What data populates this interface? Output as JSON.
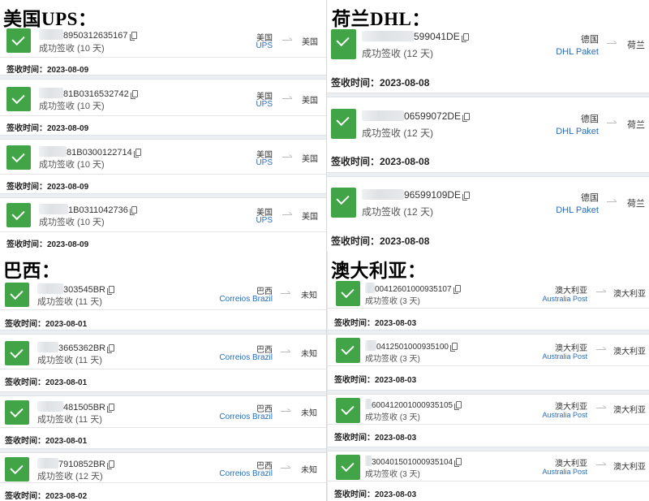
{
  "sections": {
    "us": {
      "heading": "美国UPS：",
      "shipments": [
        {
          "tracking": "8950312635167",
          "status": "成功签收 (10 天)",
          "origin": "美国",
          "carrier": "UPS",
          "destination": "美国",
          "signed": "签收时间：2023-08-09"
        },
        {
          "tracking": "81B0316532742",
          "status": "成功签收 (10 天)",
          "origin": "美国",
          "carrier": "UPS",
          "destination": "美国",
          "signed": "签收时间：2023-08-09"
        },
        {
          "tracking": "81B0300122714",
          "status": "成功签收 (10 天)",
          "origin": "美国",
          "carrier": "UPS",
          "destination": "美国",
          "signed": "签收时间：2023-08-09"
        },
        {
          "tracking": "1B0311042736",
          "status": "成功签收 (10 天)",
          "origin": "美国",
          "carrier": "UPS",
          "destination": "美国",
          "signed": "签收时间：2023-08-09"
        }
      ]
    },
    "nl": {
      "heading": "荷兰DHL：",
      "shipments": [
        {
          "tracking": "599041DE",
          "status": "成功签收 (12 天)",
          "origin": "德国",
          "carrier": "DHL Paket",
          "destination": "荷兰",
          "signed": "签收时间：2023-08-08"
        },
        {
          "tracking": "06599072DE",
          "status": "成功签收 (12 天)",
          "origin": "德国",
          "carrier": "DHL Paket",
          "destination": "荷兰",
          "signed": "签收时间：2023-08-08"
        },
        {
          "tracking": "96599109DE",
          "status": "成功签收 (12 天)",
          "origin": "德国",
          "carrier": "DHL Paket",
          "destination": "荷兰",
          "signed": "签收时间：2023-08-08"
        }
      ]
    },
    "br": {
      "heading": "巴西：",
      "shipments": [
        {
          "tracking": "303545BR",
          "status": "成功签收 (11 天)",
          "origin": "巴西",
          "carrier": "Correios Brazil",
          "destination": "未知",
          "signed": "签收时间：2023-08-01"
        },
        {
          "tracking": "3665362BR",
          "status": "成功签收 (11 天)",
          "origin": "巴西",
          "carrier": "Correios Brazil",
          "destination": "未知",
          "signed": "签收时间：2023-08-01"
        },
        {
          "tracking": "481505BR",
          "status": "成功签收 (11 天)",
          "origin": "巴西",
          "carrier": "Correios Brazil",
          "destination": "未知",
          "signed": "签收时间：2023-08-01"
        },
        {
          "tracking": "7910852BR",
          "status": "成功签收 (12 天)",
          "origin": "巴西",
          "carrier": "Correios Brazil",
          "destination": "未知",
          "signed": "签收时间：2023-08-02"
        }
      ]
    },
    "au": {
      "heading": "澳大利亚：",
      "shipments": [
        {
          "tracking": "00412601000935107",
          "status": "成功签收 (3 天)",
          "origin": "澳大利亚",
          "carrier": "Australia Post",
          "destination": "澳大利亚",
          "signed": "签收时间：2023-08-03"
        },
        {
          "tracking": "0412501000935100",
          "status": "成功签收 (3 天)",
          "origin": "澳大利亚",
          "carrier": "Australia Post",
          "destination": "澳大利亚",
          "signed": "签收时间：2023-08-03"
        },
        {
          "tracking": "600412001000935105",
          "status": "成功签收 (3 天)",
          "origin": "澳大利亚",
          "carrier": "Australia Post",
          "destination": "澳大利亚",
          "signed": "签收时间：2023-08-03"
        },
        {
          "tracking": "300401501000935104",
          "status": "成功签收 (3 天)",
          "origin": "澳大利亚",
          "carrier": "Australia Post",
          "destination": "澳大利亚",
          "signed": "签收时间：2023-08-03"
        }
      ]
    }
  },
  "colors": {
    "check": "#41a446",
    "carrier_link": "#2a6ebb"
  },
  "icons": {
    "status": "check-icon",
    "copy": "copy-icon",
    "route": "arrow-right-icon"
  }
}
